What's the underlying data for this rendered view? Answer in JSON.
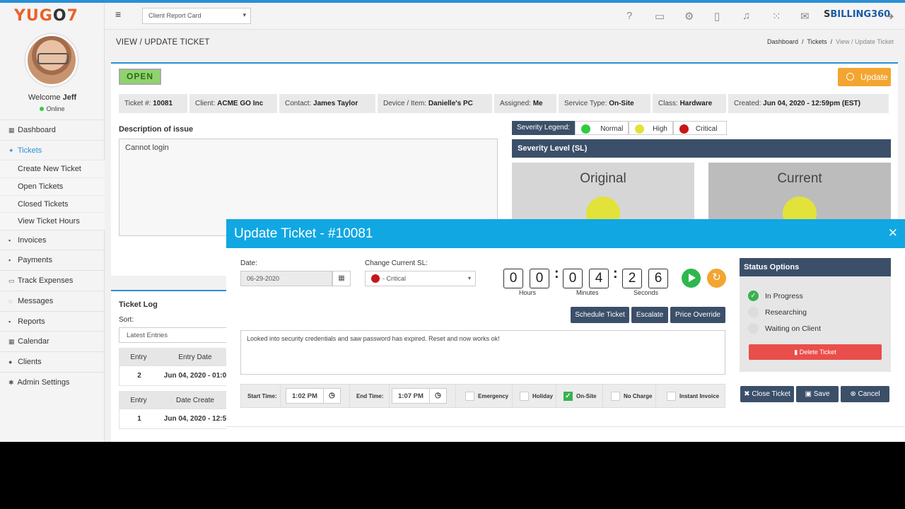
{
  "app": {
    "logo_prefix": "YUG",
    "logo_o": "O",
    "logo_suffix": "7",
    "brand_s": "S",
    "brand_rest": "BILLING360"
  },
  "user": {
    "welcome_prefix": "Welcome",
    "name": "Jeff",
    "status": "Online"
  },
  "sidebar": {
    "items": [
      {
        "label": "Dashboard"
      },
      {
        "label": "Tickets"
      },
      {
        "label": "Create New Ticket"
      },
      {
        "label": "Open Tickets"
      },
      {
        "label": "Closed Tickets"
      },
      {
        "label": "View Ticket Hours"
      },
      {
        "label": "Invoices"
      },
      {
        "label": "Payments"
      },
      {
        "label": "Track Expenses"
      },
      {
        "label": "Messages"
      },
      {
        "label": "Reports"
      },
      {
        "label": "Calendar"
      },
      {
        "label": "Clients"
      },
      {
        "label": "Admin Settings"
      }
    ]
  },
  "topbar": {
    "client_select": "Client Report Card",
    "icons": [
      "help-icon",
      "video-icon",
      "gear-icon",
      "clipboard-icon",
      "bell-icon",
      "grid-icon",
      "mail-icon",
      "logout-icon"
    ]
  },
  "page": {
    "title": "VIEW / UPDATE TICKET",
    "breadcrumb": {
      "dashboard": "Dashboard",
      "sep1": "/",
      "tickets": "Tickets",
      "sep2": "/",
      "current": "View / Update Ticket"
    }
  },
  "ticket": {
    "status_badge": "OPEN",
    "update_label": "Update",
    "info": {
      "ticket_label": "Ticket #:",
      "ticket_value": "10081",
      "client_label": "Client:",
      "client_value": "ACME GO Inc",
      "contact_label": "Contact:",
      "contact_value": "James Taylor",
      "device_label": "Device / Item:",
      "device_value": "Danielle's PC",
      "assigned_label": "Assigned:",
      "assigned_value": "Me",
      "service_label": "Service Type:",
      "service_value": "On-Site",
      "class_label": "Class:",
      "class_value": "Hardware",
      "created_label": "Created:",
      "created_value": "Jun 04, 2020 - 12:59pm (EST)"
    },
    "description_title": "Description of issue",
    "description": "Cannot login",
    "severity_legend": {
      "label": "Severity Legend:",
      "normal": "Normal",
      "high": "High",
      "critical": "Critical",
      "colors": {
        "normal": "#2ecc40",
        "high": "#e2e23a",
        "critical": "#c7161a"
      }
    },
    "severity_header": "Severity Level (SL)",
    "sl_original": "Original",
    "sl_current": "Current"
  },
  "ticket_log": {
    "title": "Ticket Log",
    "sort_label": "Sort:",
    "sort_value": "Latest Entries",
    "table1": {
      "h1": "Entry",
      "h2": "Entry Date",
      "entry": "2",
      "date": "Jun 04, 2020 - 01:0"
    },
    "table2": {
      "h1": "Entry",
      "h2": "Date Create",
      "entry": "1",
      "date": "Jun 04, 2020 - 12:5"
    }
  },
  "modal": {
    "title": "Update Ticket - #10081",
    "date_label": "Date:",
    "date_value": "06-29-2020",
    "sl_label": "Change Current SL:",
    "sl_value": "- Critical",
    "timer": {
      "digits": [
        "0",
        "0",
        "0",
        "4",
        "2",
        "6"
      ],
      "hours": "Hours",
      "minutes": "Minutes",
      "seconds": "Seconds"
    },
    "buttons": {
      "schedule": "Schedule Ticket",
      "escalate": "Escalate",
      "price_override": "Price Override"
    },
    "notes": "Looked into security credentials and saw password has expired. Reset and now works ok!",
    "start_label": "Start Time:",
    "start_value": "1:02 PM",
    "end_label": "End Time:",
    "end_value": "1:07 PM",
    "checkboxes": {
      "emergency": "Emergency",
      "holiday": "Holiday",
      "onsite": "On-Site",
      "nocharge": "No Charge",
      "instant": "Instant Invoice"
    },
    "status_options": {
      "title": "Status Options",
      "in_progress": "In Progress",
      "researching": "Researching",
      "waiting": "Waiting on Client",
      "delete": "Delete Ticket"
    },
    "footer": {
      "close": "Close Ticket",
      "save": "Save",
      "cancel": "Cancel"
    }
  }
}
